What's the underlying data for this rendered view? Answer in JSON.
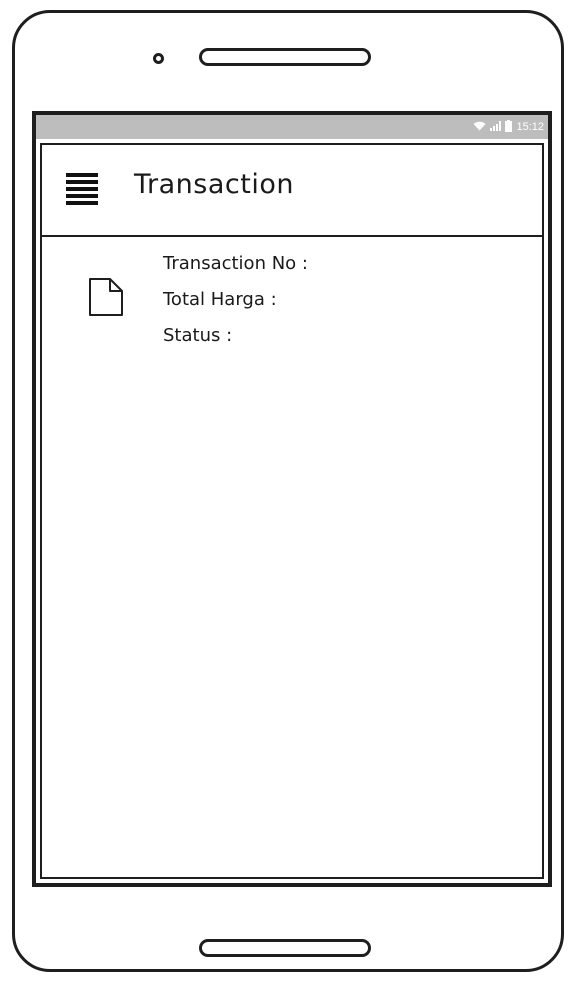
{
  "status_bar": {
    "wifi_icon": "wifi-icon",
    "signal_icon": "signal-icon",
    "battery_icon": "battery-icon",
    "time": "15:12"
  },
  "app_bar": {
    "menu_icon": "hamburger-menu-icon",
    "title": "Transaction"
  },
  "transaction_item": {
    "icon": "document-icon",
    "transaction_no_label": "Transaction No :",
    "total_harga_label": "Total Harga :",
    "status_label": "Status :"
  }
}
